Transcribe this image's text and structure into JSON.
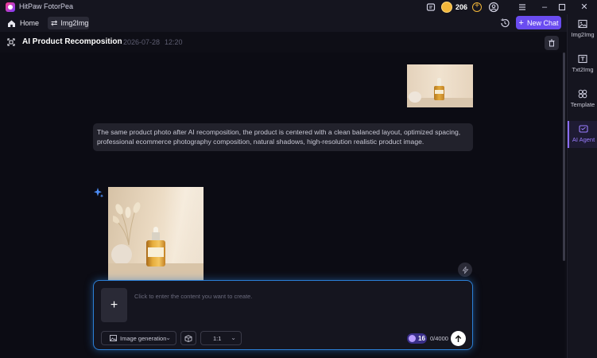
{
  "app": {
    "name": "HitPaw FotorPea",
    "credits": "206"
  },
  "nav": {
    "home_label": "Home",
    "tab_label": "Img2Img",
    "new_chat_label": "New Chat"
  },
  "header": {
    "title": "AI Product Recomposition",
    "date": "2026-07-28",
    "time": "12:20"
  },
  "chat": {
    "prompt_text": "The same product photo after AI recomposition, the product is centered with a clean balanced layout, optimized spacing, professional ecommerce photography composition, natural shadows, high-resolution realistic product image."
  },
  "composer": {
    "placeholder": "Click to enter the content you want to create.",
    "mode_label": "Image generation",
    "ratio_label": "1:1",
    "cost": "16",
    "char_count": "0/4000"
  },
  "sidebar": {
    "items": [
      {
        "label": "Img2Img",
        "icon": "image-icon",
        "active": false
      },
      {
        "label": "Txt2Img",
        "icon": "text-image-icon",
        "active": false
      },
      {
        "label": "Template",
        "icon": "template-icon",
        "active": false
      },
      {
        "label": "AI Agent",
        "icon": "ai-agent-icon",
        "active": true
      }
    ]
  },
  "colors": {
    "accent": "#6a4cf0",
    "composer_border": "#2b7fd6",
    "active_sidebar": "#9a7dff",
    "credit_coin": "#f2b63a"
  }
}
